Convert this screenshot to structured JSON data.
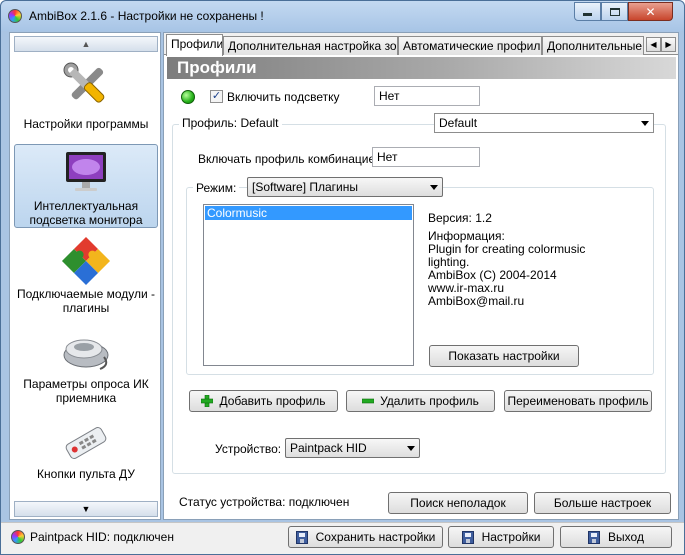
{
  "window": {
    "title": "AmbiBox 2.1.6  - Настройки не сохранены !"
  },
  "sidebar": {
    "items": [
      {
        "label": "Настройки программы",
        "icon": "tools-icon"
      },
      {
        "label": "Интеллектуальная подсветка монитора",
        "icon": "monitor-icon",
        "selected": true
      },
      {
        "label": "Подключаемые модули - плагины",
        "icon": "puzzle-icon"
      },
      {
        "label": "Параметры опроса ИК приемника",
        "icon": "ir-receiver-icon"
      },
      {
        "label": "Кнопки пульта ДУ",
        "icon": "remote-control-icon"
      }
    ]
  },
  "tabs": [
    {
      "label": "Профили",
      "active": true
    },
    {
      "label": "Дополнительная настройка зон"
    },
    {
      "label": "Автоматические профили"
    },
    {
      "label": "Дополнительные н"
    }
  ],
  "panel": {
    "header": "Профили",
    "enable_backlight_label": "Включить подсветку",
    "enable_backlight_checked": true,
    "enable_hotkey_value": "Нет",
    "profile_label": "Профиль: Default",
    "profile_selected": "Default",
    "combo_label": "Включать профиль комбинацией:",
    "combo_value": "Нет",
    "mode_label": "Режим:",
    "mode_selected": "[Software] Плагины",
    "plugins": [
      "Colormusic"
    ],
    "plugin_info": {
      "version": "Версия: 1.2",
      "info_label": "Информация:",
      "lines": [
        "Plugin for creating colormusic",
        "lighting.",
        "AmbiBox (C) 2004-2014",
        "www.ir-max.ru",
        "AmbiBox@mail.ru"
      ]
    },
    "show_settings_button": "Показать настройки",
    "add_profile_button": "Добавить профиль",
    "delete_profile_button": "Удалить профиль",
    "rename_profile_button": "Переименовать профиль",
    "device_label": "Устройство:",
    "device_selected": "Paintpack HID",
    "device_status": "Статус устройства: подключен",
    "troubleshoot_button": "Поиск неполадок",
    "more_settings_button": "Больше настроек"
  },
  "statusbar": {
    "connection_text": "Paintpack HID: подключен",
    "save_button": "Сохранить настройки",
    "settings_button": "Настройки",
    "exit_button": "Выход"
  },
  "colors": {
    "window_frame": "#a9c4e3",
    "selection": "#3399ff",
    "status_ok": "#26b21a",
    "add_green": "#22aa22"
  }
}
